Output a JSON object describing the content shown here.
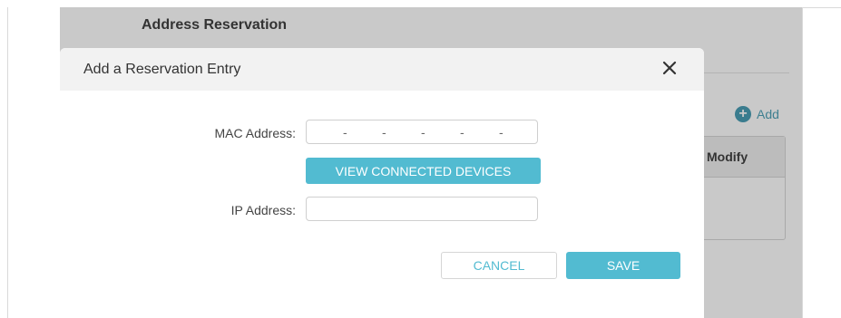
{
  "background": {
    "page_title": "Address Reservation",
    "add_label": "Add",
    "table_header_modify": "Modify"
  },
  "modal": {
    "title": "Add a Reservation Entry",
    "mac_label": "MAC Address:",
    "mac_separators": [
      "-",
      "-",
      "-",
      "-",
      "-"
    ],
    "view_devices_label": "VIEW CONNECTED DEVICES",
    "ip_label": "IP Address:",
    "ip_value": "",
    "cancel_label": "CANCEL",
    "save_label": "SAVE"
  },
  "colors": {
    "accent": "#52bbd1",
    "overlay": "#c9c9c9"
  },
  "icons": {
    "close": "close-icon",
    "add": "plus-circle-icon"
  }
}
